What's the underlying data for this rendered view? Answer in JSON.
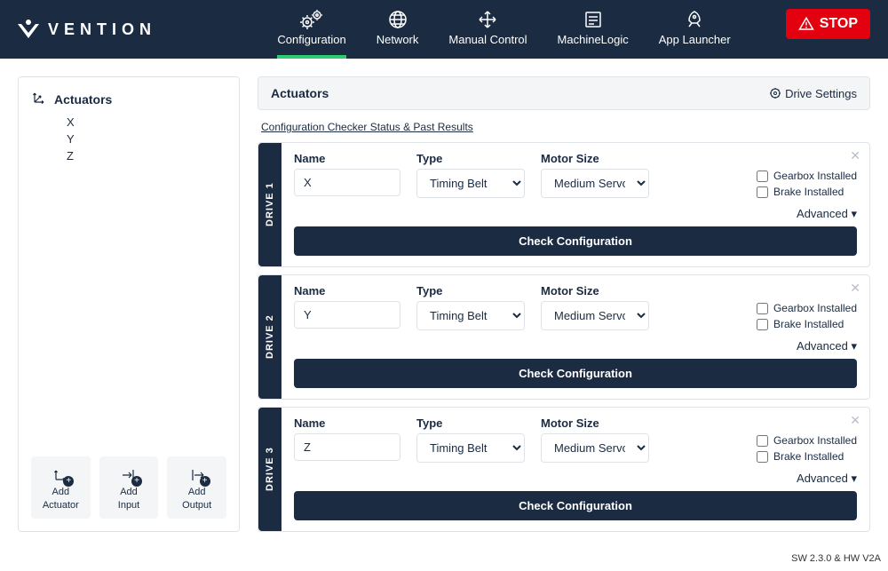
{
  "brand": "VENTION",
  "nav": {
    "items": [
      {
        "label": "Configuration"
      },
      {
        "label": "Network"
      },
      {
        "label": "Manual Control"
      },
      {
        "label": "MachineLogic"
      },
      {
        "label": "App Launcher"
      }
    ],
    "stop": "STOP"
  },
  "sidebar": {
    "title": "Actuators",
    "items": [
      "X",
      "Y",
      "Z"
    ],
    "add_actuator_l1": "Add",
    "add_actuator_l2": "Actuator",
    "add_input_l1": "Add",
    "add_input_l2": "Input",
    "add_output_l1": "Add",
    "add_output_l2": "Output"
  },
  "content": {
    "title": "Actuators",
    "drive_settings": "Drive Settings",
    "checker_link": "Configuration Checker Status & Past Results",
    "labels": {
      "name": "Name",
      "type": "Type",
      "motor": "Motor Size",
      "gearbox": "Gearbox Installed",
      "brake": "Brake Installed",
      "advanced": "Advanced",
      "check": "Check Configuration"
    },
    "drives": [
      {
        "tab": "DRIVE 1",
        "name": "X",
        "type": "Timing Belt",
        "motor": "Medium Servo"
      },
      {
        "tab": "DRIVE 2",
        "name": "Y",
        "type": "Timing Belt",
        "motor": "Medium Servo"
      },
      {
        "tab": "DRIVE 3",
        "name": "Z",
        "type": "Timing Belt",
        "motor": "Medium Servo"
      }
    ]
  },
  "footer": "SW 2.3.0 & HW V2A"
}
